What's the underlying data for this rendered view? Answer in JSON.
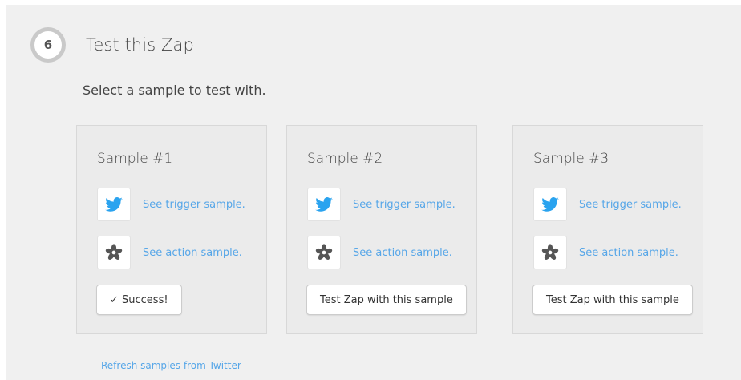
{
  "step": {
    "number": "6",
    "title": "Test this Zap"
  },
  "subtitle": "Select a sample to test with.",
  "samples": [
    {
      "title": "Sample #1",
      "trigger_link": "See trigger sample.",
      "action_link": "See action sample.",
      "button_label": "✓ Success!"
    },
    {
      "title": "Sample #2",
      "trigger_link": "See trigger sample.",
      "action_link": "See action sample.",
      "button_label": "Test Zap with this sample"
    },
    {
      "title": "Sample #3",
      "trigger_link": "See trigger sample.",
      "action_link": "See action sample.",
      "button_label": "Test Zap with this sample"
    }
  ],
  "refresh_link": "Refresh samples from Twitter",
  "icons": {
    "trigger": "twitter-icon",
    "action": "adafruit-flower-icon"
  },
  "colors": {
    "link": "#56a6e8",
    "twitter": "#2aa3ef",
    "action_icon": "#555555",
    "panel_background": "#f0f0f0",
    "card_background": "#ebebeb"
  }
}
